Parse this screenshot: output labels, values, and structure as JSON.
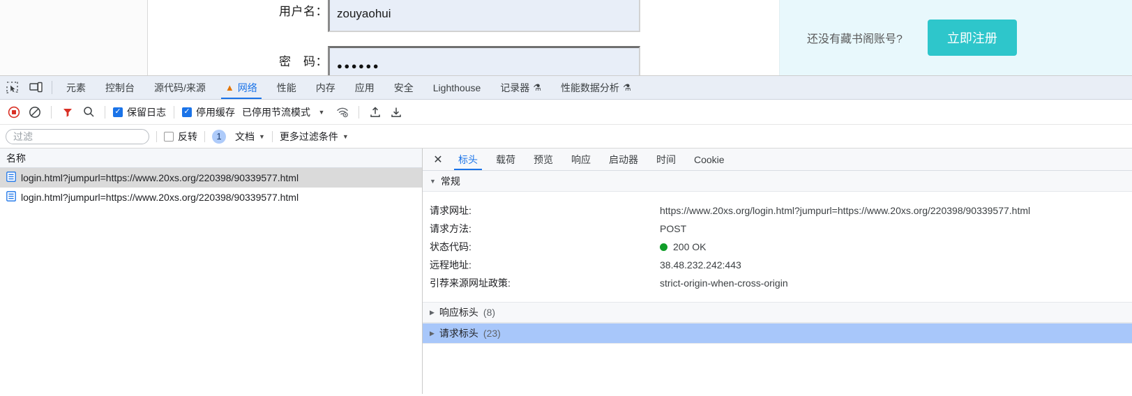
{
  "page": {
    "form": {
      "username_label": "用户名：",
      "username_value": "zouyaohui",
      "password_label": "密　码：",
      "password_dots": "●●●●●●"
    },
    "register": {
      "prompt": "还没有藏书阁账号?",
      "button_label": "立即注册",
      "button_color": "#2ec6cb"
    }
  },
  "devtools": {
    "main_tabs": [
      {
        "label": "元素",
        "active": false,
        "warn": false,
        "flask": false
      },
      {
        "label": "控制台",
        "active": false,
        "warn": false,
        "flask": false
      },
      {
        "label": "源代码/来源",
        "active": false,
        "warn": false,
        "flask": false
      },
      {
        "label": "网络",
        "active": true,
        "warn": true,
        "flask": false
      },
      {
        "label": "性能",
        "active": false,
        "warn": false,
        "flask": false
      },
      {
        "label": "内存",
        "active": false,
        "warn": false,
        "flask": false
      },
      {
        "label": "应用",
        "active": false,
        "warn": false,
        "flask": false
      },
      {
        "label": "安全",
        "active": false,
        "warn": false,
        "flask": false
      },
      {
        "label": "Lighthouse",
        "active": false,
        "warn": false,
        "flask": false
      },
      {
        "label": "记录器",
        "active": false,
        "warn": false,
        "flask": true
      },
      {
        "label": "性能数据分析",
        "active": false,
        "warn": false,
        "flask": true
      }
    ],
    "toolbar": {
      "preserve_log_label": "保留日志",
      "preserve_log_checked": true,
      "disable_cache_label": "停用缓存",
      "disable_cache_checked": true,
      "throttling_label": "已停用节流模式"
    },
    "filterbar": {
      "filter_placeholder": "过滤",
      "filter_value": "",
      "invert_label": "反转",
      "invert_checked": false,
      "type_badge": "1",
      "type_label": "文档",
      "more_filters_label": "更多过滤条件"
    },
    "request_list": {
      "column_header": "名称",
      "rows": [
        {
          "name": "login.html?jumpurl=https://www.20xs.org/220398/90339577.html",
          "selected": true
        },
        {
          "name": "login.html?jumpurl=https://www.20xs.org/220398/90339577.html",
          "selected": false
        }
      ]
    },
    "detail": {
      "tabs": [
        {
          "label": "标头",
          "active": true
        },
        {
          "label": "载荷",
          "active": false
        },
        {
          "label": "预览",
          "active": false
        },
        {
          "label": "响应",
          "active": false
        },
        {
          "label": "启动器",
          "active": false
        },
        {
          "label": "时间",
          "active": false
        },
        {
          "label": "Cookie",
          "active": false
        }
      ],
      "general": {
        "title": "常规",
        "rows": [
          {
            "key": "请求网址:",
            "value": "https://www.20xs.org/login.html?jumpurl=https://www.20xs.org/220398/90339577.html",
            "status": false
          },
          {
            "key": "请求方法:",
            "value": "POST",
            "status": false
          },
          {
            "key": "状态代码:",
            "value": "200 OK",
            "status": true
          },
          {
            "key": "远程地址:",
            "value": "38.48.232.242:443",
            "status": false
          },
          {
            "key": "引荐来源网址政策:",
            "value": "strict-origin-when-cross-origin",
            "status": false
          }
        ]
      },
      "collapsed_sections": [
        {
          "label": "响应标头",
          "count": "(8)",
          "selected": false
        },
        {
          "label": "请求标头",
          "count": "(23)",
          "selected": true
        }
      ]
    }
  }
}
